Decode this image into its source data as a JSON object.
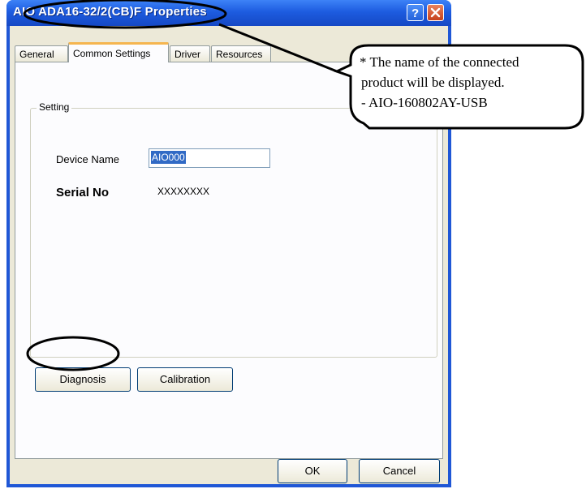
{
  "window": {
    "title": "AIO ADA16-32/2(CB)F Properties"
  },
  "tabs": [
    {
      "label": "General"
    },
    {
      "label": "Common Settings"
    },
    {
      "label": "Driver"
    },
    {
      "label": "Resources"
    }
  ],
  "setting": {
    "group_label": "Setting",
    "device_name_label": "Device Name",
    "device_name_value": "AIO000",
    "serial_label": "Serial No",
    "serial_value": "XXXXXXXX"
  },
  "buttons": {
    "diagnosis": "Diagnosis",
    "calibration": "Calibration",
    "ok": "OK",
    "cancel": "Cancel"
  },
  "callout": {
    "line1": "* The name of the connected",
    "line2": "product will be displayed.",
    "line3": "- AIO-160802AY-USB"
  }
}
